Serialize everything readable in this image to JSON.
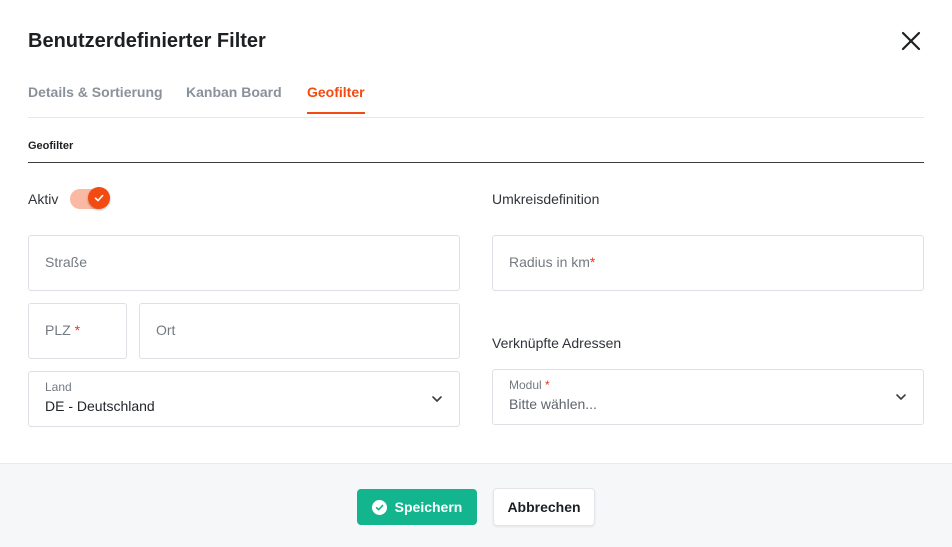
{
  "dialog": {
    "title": "Benutzerdefinierter Filter"
  },
  "tabs": [
    {
      "label": "Details & Sortierung",
      "active": false
    },
    {
      "label": "Kanban Board",
      "active": false
    },
    {
      "label": "Geofilter",
      "active": true
    }
  ],
  "section": {
    "title": "Geofilter"
  },
  "aktiv": {
    "label": "Aktiv",
    "on": true
  },
  "address": {
    "street_placeholder": "Straße",
    "plz_placeholder": "PLZ",
    "ort_placeholder": "Ort",
    "land_label": "Land",
    "land_value": "DE - Deutschland"
  },
  "umkreis": {
    "heading": "Umkreisdefinition",
    "radius_placeholder": "Radius in km"
  },
  "verknuepfte": {
    "heading": "Verknüpfte Adressen",
    "modul_label": "Modul",
    "modul_value": "Bitte wählen..."
  },
  "required_marker": "*",
  "footer": {
    "save_label": "Speichern",
    "cancel_label": "Abbrechen"
  },
  "colors": {
    "accent": "#f24a10",
    "save_button": "#13b58e"
  },
  "icons": {
    "close": "close-icon",
    "toggle_check": "check-icon",
    "dropdown": "chevron-down-icon",
    "save": "check-circle-icon"
  }
}
